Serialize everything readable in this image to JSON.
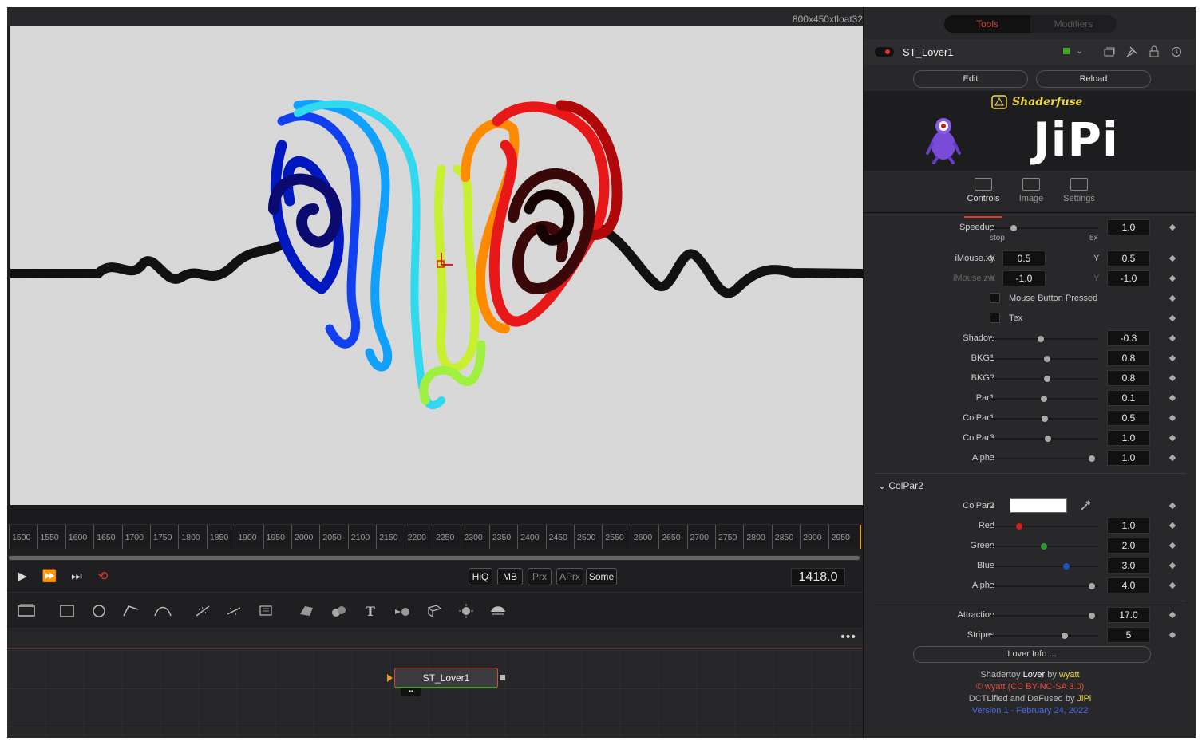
{
  "viewer": {
    "resolution": "800x450xfloat32",
    "ruler_ticks": [
      "1500",
      "1550",
      "1600",
      "1650",
      "1700",
      "1750",
      "1800",
      "1850",
      "1900",
      "1950",
      "2000",
      "2050",
      "2100",
      "2150",
      "2200",
      "2250",
      "2300",
      "2350",
      "2400",
      "2450",
      "2500",
      "2550",
      "2600",
      "2650",
      "2700",
      "2750",
      "2800",
      "2850",
      "2900",
      "2950"
    ],
    "quality_buttons": {
      "hiq": "HiQ",
      "mb": "MB",
      "prx": "Prx",
      "aprx": "APrx",
      "some": "Some"
    },
    "current_frame": "1418.0"
  },
  "flow": {
    "node_name": "ST_Lover1",
    "more": "•••"
  },
  "inspector": {
    "tabs": {
      "tools": "Tools",
      "modifiers": "Modifiers"
    },
    "tool_name": "ST_Lover1",
    "edit_label": "Edit",
    "reload_label": "Reload",
    "brand": "Shaderfuse",
    "logo_text": "JiPi",
    "panel_tabs": {
      "controls": "Controls",
      "image": "Image",
      "settings": "Settings"
    },
    "speedup": {
      "label": "Speedup",
      "value": "1.0",
      "min_label": "stop",
      "max_label": "5x",
      "level": 0.2
    },
    "imouse_xy": {
      "label": "iMouse.xy",
      "x_label": "X",
      "x": "0.5",
      "y_label": "Y",
      "y": "0.5"
    },
    "imouse_zw": {
      "label": "iMouse.zw",
      "x_label": "X",
      "x": "-1.0",
      "y_label": "Y",
      "y": "-1.0"
    },
    "mouse_button_pressed": "Mouse Button Pressed",
    "tex": "Tex",
    "sliders": [
      {
        "label": "Shadow",
        "value": "-0.3",
        "level": 0.47
      },
      {
        "label": "BKG1",
        "value": "0.8",
        "level": 0.53
      },
      {
        "label": "BKG2",
        "value": "0.8",
        "level": 0.53
      },
      {
        "label": "Par1",
        "value": "0.1",
        "level": 0.5
      },
      {
        "label": "ColPar1",
        "value": "0.5",
        "level": 0.51
      },
      {
        "label": "ColPar3",
        "value": "1.0",
        "level": 0.54
      },
      {
        "label": "Alpha",
        "value": "1.0",
        "level": 0.97
      }
    ],
    "colpar2": {
      "section_title": "ColPar2",
      "label": "ColPar2",
      "swatch_color": "#ffffff",
      "channels": [
        {
          "label": "Red",
          "value": "1.0",
          "level": 0.26,
          "color": "#d02020"
        },
        {
          "label": "Green",
          "value": "2.0",
          "level": 0.5,
          "color": "#2a9a2a"
        },
        {
          "label": "Blue",
          "value": "3.0",
          "level": 0.72,
          "color": "#2050c0"
        },
        {
          "label": "Alpha",
          "value": "4.0",
          "level": 0.97,
          "color": "#aaaaaa"
        }
      ]
    },
    "attraction": {
      "label": "Attraction",
      "value": "17.0",
      "level": 0.97
    },
    "stripes": {
      "label": "Stripes",
      "value": "5",
      "level": 0.7
    },
    "lover_info": "Lover Info ...",
    "credits": {
      "line1_a": "Shadertoy ",
      "line1_b": "Lover",
      "line1_c": " by ",
      "line1_d": "wyatt",
      "line2": "© wyatt (CC BY-NC-SA 3.0)",
      "line3_a": "DCTLified and DaFused by ",
      "line3_b": "JiPi",
      "line4": "Version 1 - February 24, 2022"
    }
  }
}
